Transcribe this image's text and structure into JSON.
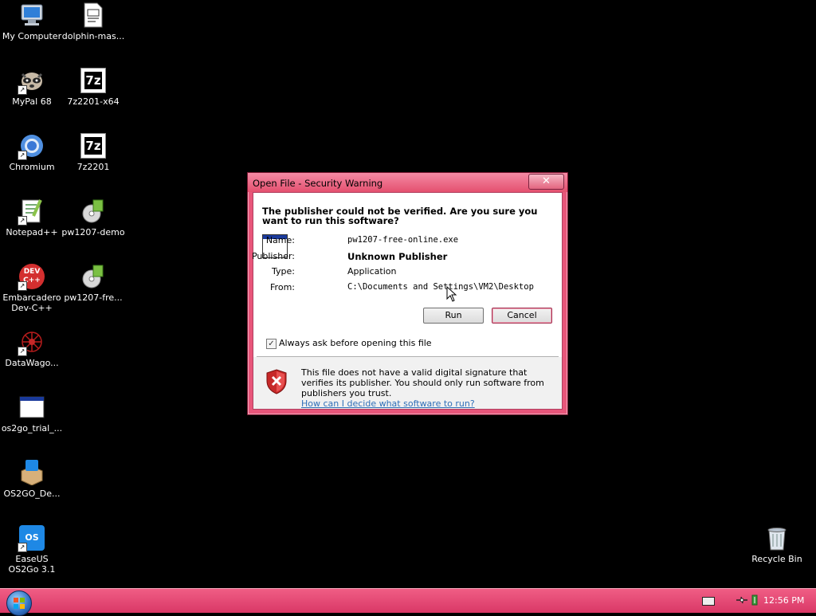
{
  "desktop": {
    "icons": [
      {
        "label": "My Computer"
      },
      {
        "label": "dolphin-mas..."
      },
      {
        "label": "MyPal 68"
      },
      {
        "label": "7z2201-x64"
      },
      {
        "label": "Chromium"
      },
      {
        "label": "7z2201"
      },
      {
        "label": "Notepad++"
      },
      {
        "label": "pw1207-demo"
      },
      {
        "label": "Embarcadero Dev-C++"
      },
      {
        "label": "pw1207-fre..."
      },
      {
        "label": "DataWago..."
      },
      {
        "label": "os2go_trial_..."
      },
      {
        "label": "OS2GO_De..."
      },
      {
        "label": "EaseUS OS2Go 3.1"
      },
      {
        "label": "Recycle Bin"
      }
    ],
    "icon_glyphs": {
      "sevenzip": "7z",
      "devcpp": "DEV\nC++",
      "os2go": "OS"
    }
  },
  "dialog": {
    "title": "Open File - Security Warning",
    "close_label": "✕",
    "headline": "The publisher could not be verified.  Are you sure you want to run this software?",
    "fields": [
      {
        "label": "Name:",
        "value": "pw1207-free-online.exe"
      },
      {
        "label": "Publisher:",
        "value": "Unknown Publisher"
      },
      {
        "label": "Type:",
        "value": "Application"
      },
      {
        "label": "From:",
        "value": "C:\\Documents and Settings\\VM2\\Desktop"
      }
    ],
    "run_label": "Run",
    "cancel_label": "Cancel",
    "checkbox": {
      "label": "Always ask before opening this file",
      "checked": true,
      "mark": "✓"
    },
    "warning_text": "This file does not have a valid digital signature that verifies its publisher.  You should only run software from publishers you trust.",
    "warning_link": "How can I decide what software to run?"
  },
  "taskbar": {
    "clock": "12:56 PM"
  },
  "colors": {
    "accent": "#e8567a",
    "taskbar": "#e04470",
    "link": "#2f6fb8"
  }
}
